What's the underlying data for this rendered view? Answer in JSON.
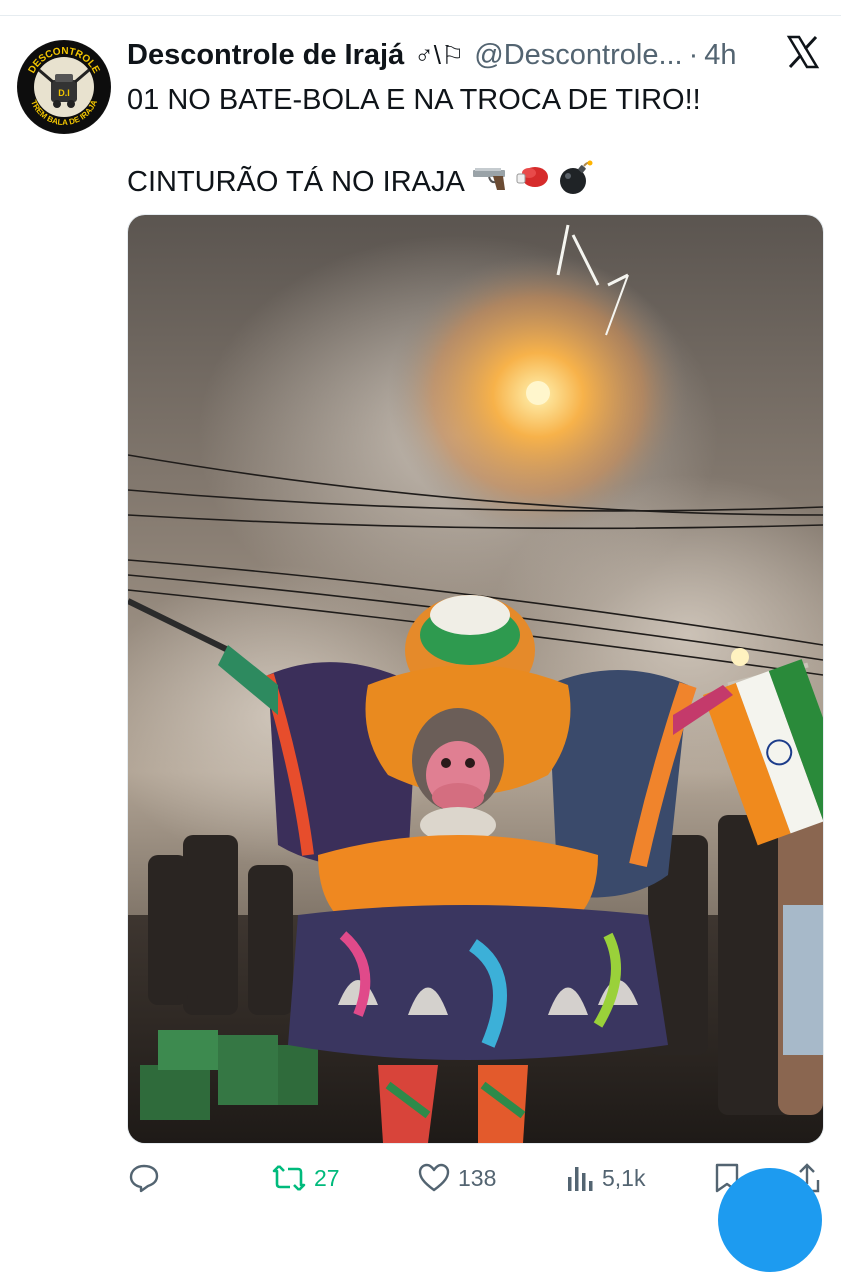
{
  "tweet": {
    "display_name": "Descontrole de Irajá",
    "name_icons": "♂\\⚐",
    "handle": "@Descontrole...",
    "separator": "·",
    "time": "4h",
    "line1": "01 NO BATE-BOLA E NA TROCA DE TIRO!!",
    "line2": "CINTURÃO TÁ NO IRAJA",
    "emojis": [
      "pistol",
      "boxing-glove",
      "bomb"
    ]
  },
  "avatar": {
    "top_text": "DESCONTROLE",
    "bottom_text": "TREM BALA DE IRAJÁ",
    "center_text": "D.I"
  },
  "actions": {
    "retweets": "27",
    "likes": "138",
    "views": "5,1k"
  },
  "colors": {
    "retweet": "#00ba7c",
    "muted": "#536471",
    "accent": "#1d9bf0"
  }
}
